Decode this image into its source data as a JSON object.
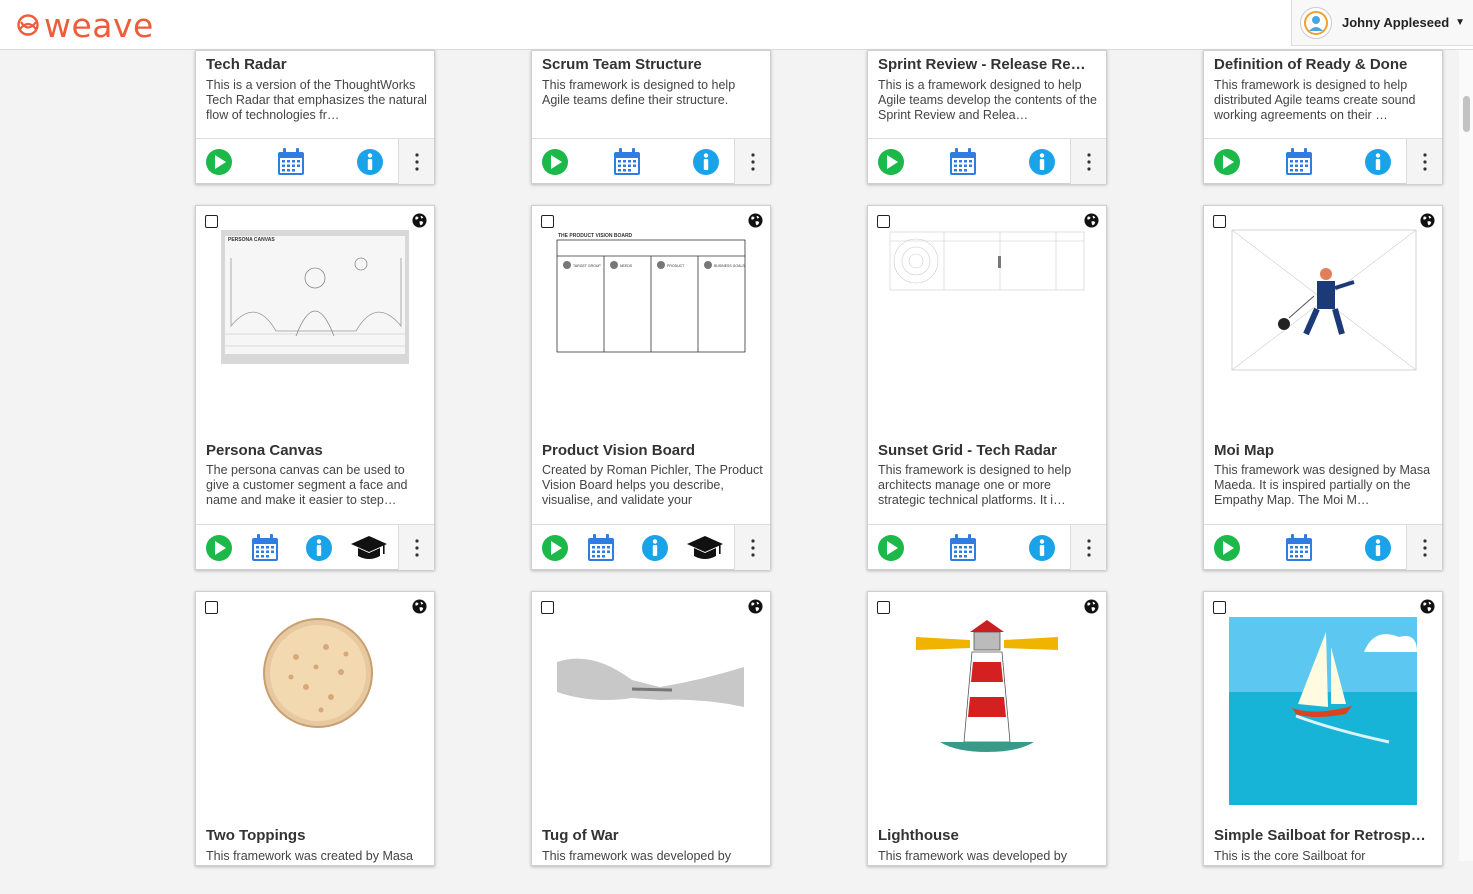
{
  "app": {
    "logo_text": "weave",
    "brand_color": "#ee5d3b"
  },
  "user": {
    "name": "Johny Appleseed",
    "caret": "▼"
  },
  "icons": {
    "play": "play-circle-icon",
    "calendar": "calendar-icon",
    "info": "info-circle-icon",
    "training": "graduation-cap-icon",
    "public": "globe-icon",
    "more": "vertical-ellipsis-icon"
  },
  "colors": {
    "play": "#1cb84a",
    "calendar": "#2f7de1",
    "info": "#1aa3e8"
  },
  "cards": [
    {
      "title": "Tech Radar",
      "description": "This is a version of the ThoughtWorks Tech Radar that emphasizes the natural flow of technologies fr…"
    },
    {
      "title": "Scrum Team Structure",
      "description": "This framework is designed to help Agile teams define their structure."
    },
    {
      "title": "Sprint Review - Release Re…",
      "description": "This is a framework designed to help Agile teams develop the contents of the Sprint Review and Relea…"
    },
    {
      "title": "Definition of Ready & Done",
      "description": "This framework is designed to help distributed Agile teams create sound working agreements on their …"
    },
    {
      "title": "Persona Canvas",
      "description": "The persona canvas can be used to give a customer segment a face and name and make it easier to step…",
      "thumb_title": "PERSONA CANVAS"
    },
    {
      "title": "Product Vision Board",
      "description": "Created by Roman Pichler, The Product Vision Board helps you describe, visualise, and validate your",
      "thumb_title": "THE PRODUCT VISION BOARD",
      "thumb_cols": [
        "TARGET GROUP",
        "NEEDS",
        "PRODUCT",
        "BUSINESS GOALS"
      ]
    },
    {
      "title": "Sunset Grid - Tech Radar",
      "description": "This framework is designed to help architects manage one or more strategic technical platforms. It i…"
    },
    {
      "title": "Moi Map",
      "description": "This framework was designed by Masa Maeda. It is inspired partially on the Empathy Map. The Moi M…"
    },
    {
      "title": "Two Toppings",
      "description": "This framework was created by Masa"
    },
    {
      "title": "Tug of War",
      "description": "This framework was developed by"
    },
    {
      "title": "Lighthouse",
      "description": "This framework was developed by"
    },
    {
      "title": "Simple Sailboat for Retrosp…",
      "description": "This is the core Sailboat for"
    }
  ]
}
